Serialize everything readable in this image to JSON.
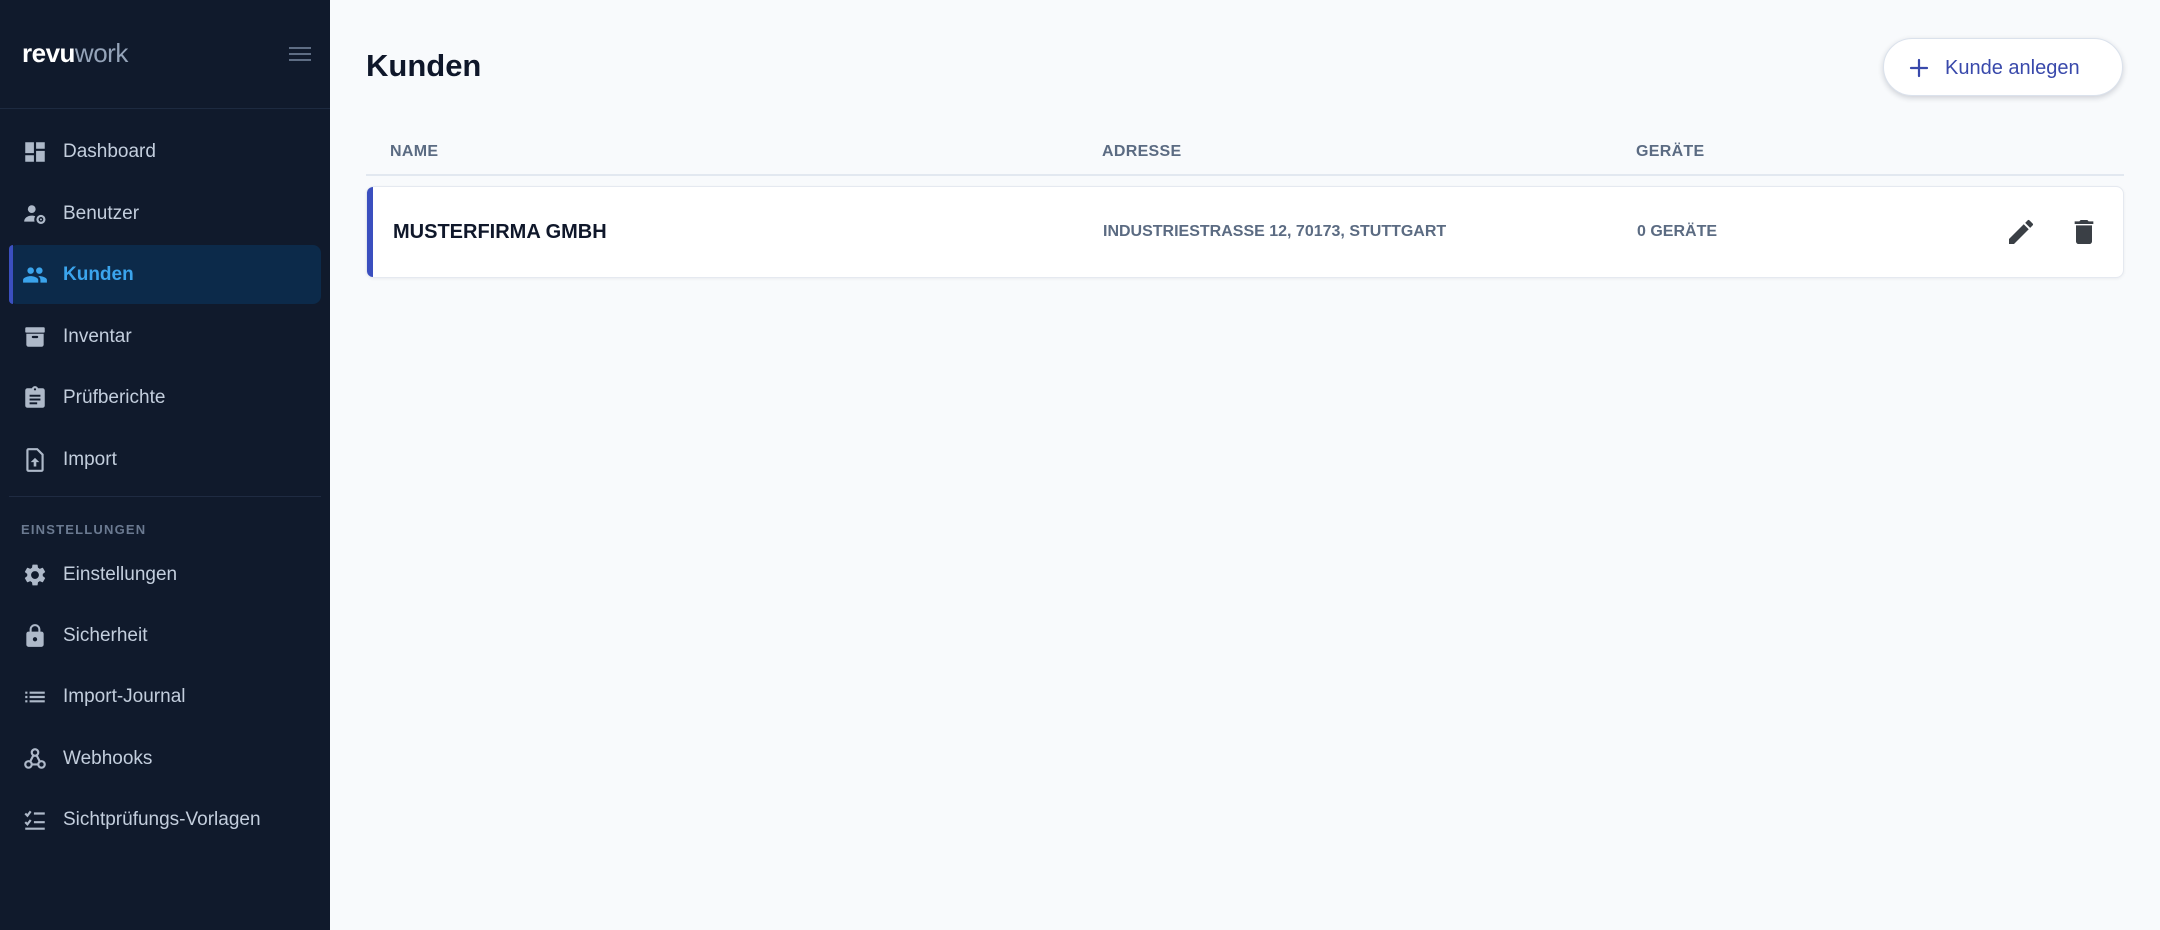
{
  "brand": {
    "bold": "revu",
    "light": "work"
  },
  "sidebar": {
    "items": [
      {
        "label": "Dashboard",
        "icon": "dashboard-icon"
      },
      {
        "label": "Benutzer",
        "icon": "user-gear-icon"
      },
      {
        "label": "Kunden",
        "icon": "people-icon",
        "active": true
      },
      {
        "label": "Inventar",
        "icon": "archive-icon"
      },
      {
        "label": "Prüfberichte",
        "icon": "clipboard-icon"
      },
      {
        "label": "Import",
        "icon": "file-upload-icon"
      }
    ],
    "section_label": "EINSTELLUNGEN",
    "settings_items": [
      {
        "label": "Einstellungen",
        "icon": "gear-icon"
      },
      {
        "label": "Sicherheit",
        "icon": "lock-icon"
      },
      {
        "label": "Import-Journal",
        "icon": "list-icon"
      },
      {
        "label": "Webhooks",
        "icon": "webhook-icon"
      },
      {
        "label": "Sichtprüfungs-Vorlagen",
        "icon": "checklist-icon"
      }
    ]
  },
  "main": {
    "title": "Kunden",
    "add_button": "Kunde anlegen",
    "columns": [
      "NAME",
      "ADRESSE",
      "GERÄTE"
    ],
    "rows": [
      {
        "name": "MUSTERFIRMA GMBH",
        "address": "INDUSTRIESTRASSE 12, 70173, STUTTGART",
        "devices": "0 GERÄTE"
      }
    ]
  },
  "colors": {
    "sidebar_bg": "#101a2c",
    "active_bg": "#0c2a4a",
    "active_text": "#3ba4ec",
    "accent": "#3b4fbf",
    "page_bg": "#f8fafc"
  }
}
